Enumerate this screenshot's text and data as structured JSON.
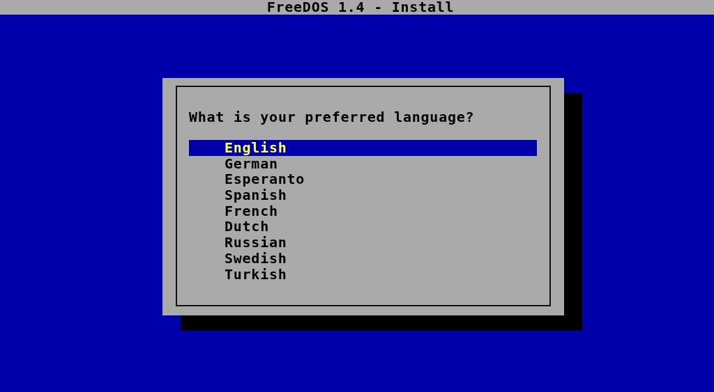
{
  "title_bar": {
    "title": "FreeDOS 1.4 - Install"
  },
  "dialog": {
    "prompt": "What is your preferred language?",
    "options": [
      {
        "label": "English",
        "selected": true
      },
      {
        "label": "German",
        "selected": false
      },
      {
        "label": "Esperanto",
        "selected": false
      },
      {
        "label": "Spanish",
        "selected": false
      },
      {
        "label": "French",
        "selected": false
      },
      {
        "label": "Dutch",
        "selected": false
      },
      {
        "label": "Russian",
        "selected": false
      },
      {
        "label": "Swedish",
        "selected": false
      },
      {
        "label": "Turkish",
        "selected": false
      }
    ]
  }
}
